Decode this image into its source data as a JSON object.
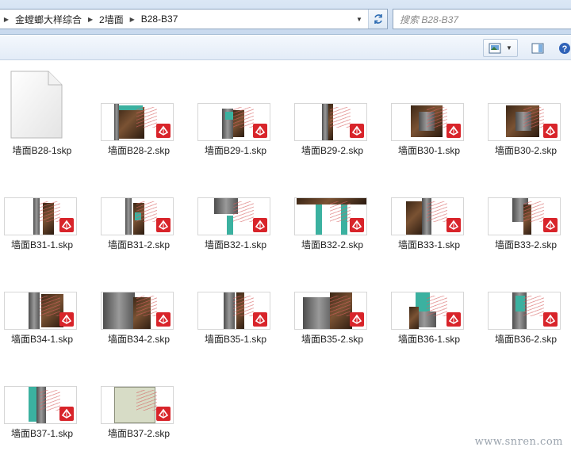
{
  "address": {
    "breadcrumbs": [
      "金螳螂大样综合",
      "2墙面",
      "B28-B37"
    ]
  },
  "search": {
    "placeholder": "搜索 B28-B37"
  },
  "toolbar": {
    "view_icon": "view-icon",
    "preview_pane_icon": "preview-pane-icon",
    "help_icon": "help-icon"
  },
  "files": [
    {
      "name": "墙面B28-1skp",
      "kind": "generic"
    },
    {
      "name": "墙面B28-2.skp",
      "kind": "skp"
    },
    {
      "name": "墙面B29-1.skp",
      "kind": "skp"
    },
    {
      "name": "墙面B29-2.skp",
      "kind": "skp"
    },
    {
      "name": "墙面B30-1.skp",
      "kind": "skp"
    },
    {
      "name": "墙面B30-2.skp",
      "kind": "skp"
    },
    {
      "name": "墙面B31-1.skp",
      "kind": "skp"
    },
    {
      "name": "墙面B31-2.skp",
      "kind": "skp"
    },
    {
      "name": "墙面B32-1.skp",
      "kind": "skp"
    },
    {
      "name": "墙面B32-2.skp",
      "kind": "skp"
    },
    {
      "name": "墙面B33-1.skp",
      "kind": "skp"
    },
    {
      "name": "墙面B33-2.skp",
      "kind": "skp"
    },
    {
      "name": "墙面B34-1.skp",
      "kind": "skp"
    },
    {
      "name": "墙面B34-2.skp",
      "kind": "skp"
    },
    {
      "name": "墙面B35-1.skp",
      "kind": "skp"
    },
    {
      "name": "墙面B35-2.skp",
      "kind": "skp"
    },
    {
      "name": "墙面B36-1.skp",
      "kind": "skp"
    },
    {
      "name": "墙面B36-2.skp",
      "kind": "skp"
    },
    {
      "name": "墙面B37-1.skp",
      "kind": "skp"
    },
    {
      "name": "墙面B37-2.skp",
      "kind": "skp"
    }
  ],
  "watermark": "www.snren.com",
  "colors": {
    "skp_badge": "#d8242a",
    "selection_chrome": "#c8d9ee"
  }
}
